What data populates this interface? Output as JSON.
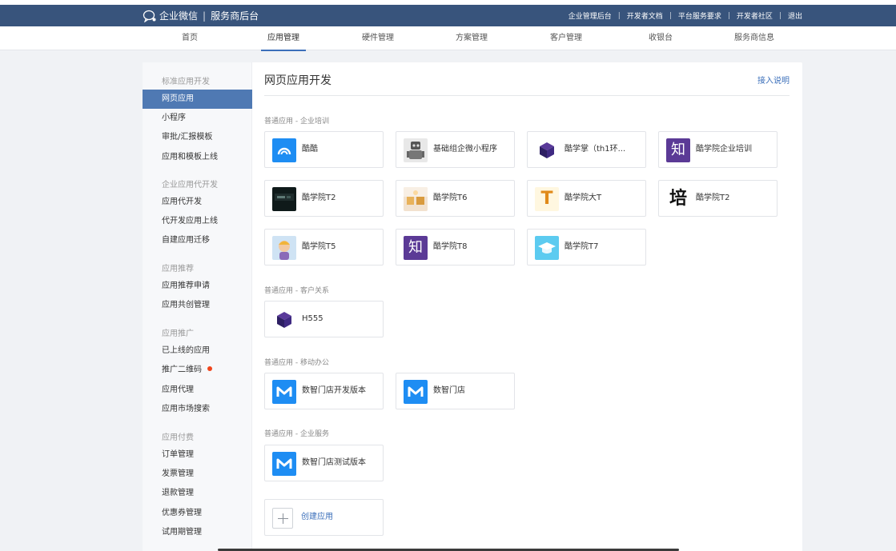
{
  "topbar": {
    "brand_name": "企业微信",
    "brand_sep": "|",
    "brand_sub": "服务商后台",
    "links": [
      "企业管理后台",
      "开发者文档",
      "平台服务要求",
      "开发者社区",
      "退出"
    ]
  },
  "nav": {
    "items": [
      "首页",
      "应用管理",
      "硬件管理",
      "方案管理",
      "客户管理",
      "收银台",
      "服务商信息"
    ],
    "active": "应用管理"
  },
  "sidebar": {
    "groups": [
      {
        "title": "标准应用开发",
        "items": [
          "网页应用",
          "小程序",
          "审批/汇报模板",
          "应用和模板上线"
        ]
      },
      {
        "title": "企业应用代开发",
        "items": [
          "应用代开发",
          "代开发应用上线",
          "自建应用迁移"
        ]
      },
      {
        "title": "应用推荐",
        "items": [
          "应用推荐申请",
          "应用共创管理"
        ]
      },
      {
        "title": "应用推广",
        "items": [
          "已上线的应用",
          "推广二维码",
          "应用代理",
          "应用市场搜索"
        ]
      },
      {
        "title": "应用付费",
        "items": [
          "订单管理",
          "发票管理",
          "退款管理",
          "优惠券管理",
          "试用期管理"
        ]
      }
    ],
    "active_item": "网页应用",
    "badge_item": "推广二维码"
  },
  "main": {
    "title": "网页应用开发",
    "help_link": "接入说明",
    "sections": [
      {
        "label": "普通应用 - 企业培训",
        "apps": [
          {
            "name": "酷酷",
            "icon": "cloud-app-icon"
          },
          {
            "name": "基础组企微小程序",
            "icon": "robot-photo-icon"
          },
          {
            "name": "酷学掌（th1环...",
            "icon": "cube-logo-icon"
          },
          {
            "name": "酷学院企业培训",
            "icon": "zhi-logo-icon"
          },
          {
            "name": "酷学院T2",
            "icon": "dark-photo-icon"
          },
          {
            "name": "酷学院T6",
            "icon": "room-photo-icon"
          },
          {
            "name": "酷学院大T",
            "icon": "letter-t-icon"
          },
          {
            "name": "酷学院T2",
            "icon": "pei-character-icon"
          },
          {
            "name": "酷学院T5",
            "icon": "cartoon-avatar-icon"
          },
          {
            "name": "酷学院T8",
            "icon": "zhi-logo-icon"
          },
          {
            "name": "酷学院T7",
            "icon": "graduation-cap-icon"
          }
        ]
      },
      {
        "label": "普通应用 - 客户关系",
        "apps": [
          {
            "name": "H555",
            "icon": "cube-logo-icon"
          }
        ]
      },
      {
        "label": "普通应用 - 移动办公",
        "apps": [
          {
            "name": "数智门店开发版本",
            "icon": "m-logo-icon"
          },
          {
            "name": "数智门店",
            "icon": "m-logo-icon"
          }
        ]
      },
      {
        "label": "普通应用 - 企业服务",
        "apps": [
          {
            "name": "数智门店测试版本",
            "icon": "m-logo-icon"
          }
        ]
      }
    ],
    "create_label": "创建应用"
  },
  "icon_text": {
    "zhi": "知",
    "pei": "培",
    "t": "T"
  },
  "colors": {
    "topbar": "#38547c",
    "accent": "#3b6fba",
    "active_side": "#4f79b3",
    "badge": "#f0451b"
  }
}
